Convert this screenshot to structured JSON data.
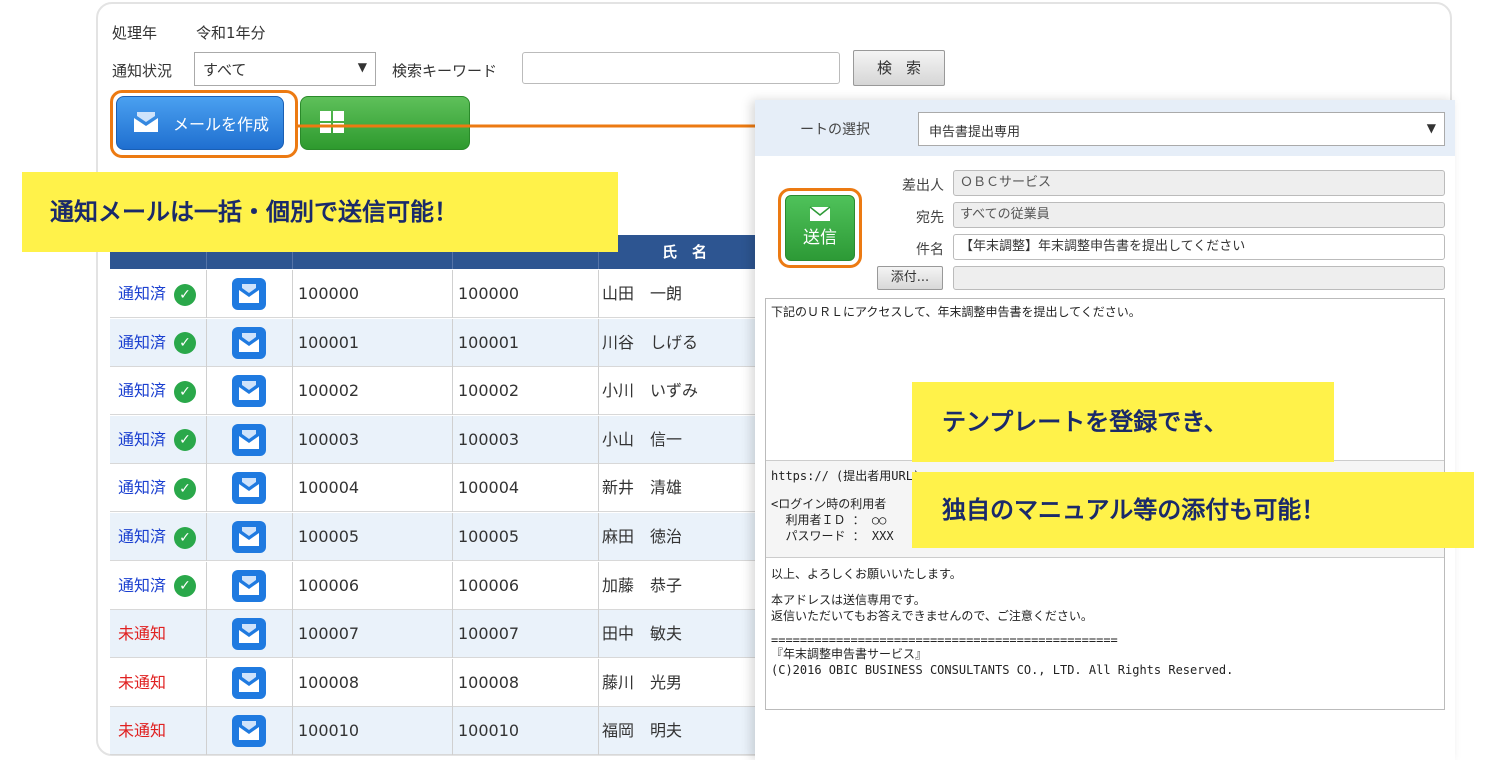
{
  "filter": {
    "year_label": "処理年",
    "year_value": "令和1年分",
    "status_label": "通知状況",
    "status_value": "すべて",
    "keyword_label": "検索キーワード",
    "keyword_value": "",
    "search_button": "検索"
  },
  "buttons": {
    "create_mail": "メールを作成"
  },
  "callouts": {
    "bulk": "通知メールは一括・個別で送信可能！",
    "template_line1": "テンプレートを登録でき、",
    "template_line2": "独自のマニュアル等の添付も可能！"
  },
  "table": {
    "name_header": "氏　名",
    "rows": [
      {
        "status": "通知済",
        "done": true,
        "user_id": "100000",
        "emp_no": "100000",
        "name": "山田　一朗"
      },
      {
        "status": "通知済",
        "done": true,
        "user_id": "100001",
        "emp_no": "100001",
        "name": "川谷　しげる"
      },
      {
        "status": "通知済",
        "done": true,
        "user_id": "100002",
        "emp_no": "100002",
        "name": "小川　いずみ"
      },
      {
        "status": "通知済",
        "done": true,
        "user_id": "100003",
        "emp_no": "100003",
        "name": "小山　信一"
      },
      {
        "status": "通知済",
        "done": true,
        "user_id": "100004",
        "emp_no": "100004",
        "name": "新井　清雄"
      },
      {
        "status": "通知済",
        "done": true,
        "user_id": "100005",
        "emp_no": "100005",
        "name": "麻田　徳治"
      },
      {
        "status": "通知済",
        "done": true,
        "user_id": "100006",
        "emp_no": "100006",
        "name": "加藤　恭子"
      },
      {
        "status": "未通知",
        "done": false,
        "user_id": "100007",
        "emp_no": "100007",
        "name": "田中　敏夫"
      },
      {
        "status": "未通知",
        "done": false,
        "user_id": "100008",
        "emp_no": "100008",
        "name": "藤川　光男"
      },
      {
        "status": "未通知",
        "done": false,
        "user_id": "100010",
        "emp_no": "100010",
        "name": "福岡　明夫"
      }
    ]
  },
  "mail_form": {
    "template_label": "ートの選択",
    "template_value": "申告書提出専用",
    "send_button": "送信",
    "sender_label": "差出人",
    "sender_value": "ＯＢＣサービス",
    "to_label": "宛先",
    "to_value": "すべての従業員",
    "subject_label": "件名",
    "subject_value": "【年末調整】年末調整申告書を提出してください",
    "attach_button": "添付...",
    "body_line1": "下記のＵＲＬにアクセスして、年末調整申告書を提出してください。",
    "body_url": "https:// (提出者用URL)",
    "body_login1": "<ログイン時の利用者",
    "body_login2": "  利用者ＩＤ ： ○○",
    "body_login3": "  パスワード ： XXX",
    "body_closing": "以上、よろしくお願いいたします。",
    "body_notice1": "本アドレスは送信専用です。",
    "body_notice2": "返信いただいてもお答えできませんので、ご注意ください。",
    "body_divider": "================================================",
    "body_service": "『年末調整申告書サービス』",
    "body_copyright": "(C)2016 OBIC BUSINESS CONSULTANTS CO., LTD. All Rights Reserved."
  },
  "colors": {
    "accent_orange": "#ec7a12",
    "callout_yellow": "#fff24a",
    "header_blue": "#2d5591",
    "done_blue": "#1a3fd0",
    "pending_red": "#e02020"
  }
}
